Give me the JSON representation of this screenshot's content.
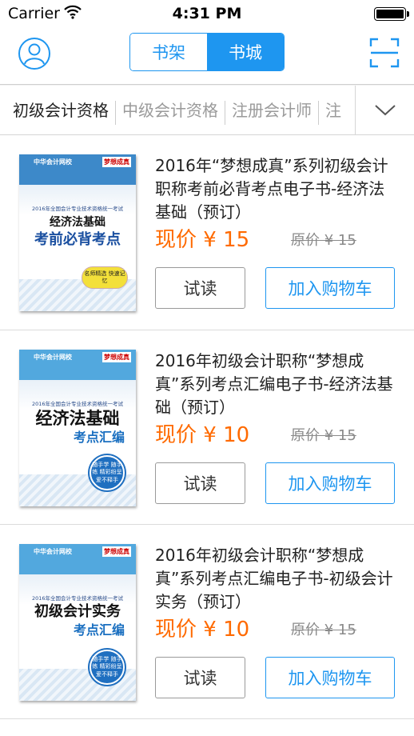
{
  "status_bar": {
    "carrier": "Carrier",
    "time": "4:31 PM"
  },
  "nav": {
    "segments": {
      "shelf": "书架",
      "store": "书城"
    },
    "active_segment": "store"
  },
  "categories": {
    "items": [
      "初级会计资格",
      "中级会计资格",
      "注册会计师",
      "注"
    ],
    "active_index": 0
  },
  "books": [
    {
      "title": "2016年“梦想成真”系列初级会计职称考前必背考点电子书-经济法基础（预订）",
      "price_now": "现价 ¥ 15",
      "price_orig": "原价 ¥ 15",
      "read_label": "试读",
      "cart_label": "加入购物车",
      "cover": {
        "brand": "中华会计网校",
        "series": "梦想成真",
        "sub": "2016年全国会计专业技术资格统一考试",
        "line1": "经济法基础",
        "line2": "考前必背考点",
        "badge": "名师精选 快速记忆"
      }
    },
    {
      "title": "2016年初级会计职称“梦想成真”系列考点汇编电子书-经济法基础（预订）",
      "price_now": "现价 ¥ 10",
      "price_orig": "原价 ¥ 15",
      "read_label": "试读",
      "cart_label": "加入购物车",
      "cover": {
        "brand": "中华会计网校",
        "series": "梦想成真",
        "sub": "2016年全国会计专业技术资格统一考试",
        "line1": "经济法基础",
        "line2": "考点汇编",
        "badge": "随手学 随手练 精彩纷呈 爱不释手"
      }
    },
    {
      "title": "2016年初级会计职称“梦想成真”系列考点汇编电子书-初级会计实务（预订）",
      "price_now": "现价 ¥ 10",
      "price_orig": "原价 ¥ 15",
      "read_label": "试读",
      "cart_label": "加入购物车",
      "cover": {
        "brand": "中华会计网校",
        "series": "梦想成真",
        "sub": "2016年全国会计专业技术资格统一考试",
        "line1": "初级会计实务",
        "line2": "考点汇编",
        "badge": "随手学 随手练 精彩纷呈 爱不释手"
      }
    }
  ],
  "colors": {
    "accent": "#1e96f0",
    "price": "#ff6a00"
  }
}
